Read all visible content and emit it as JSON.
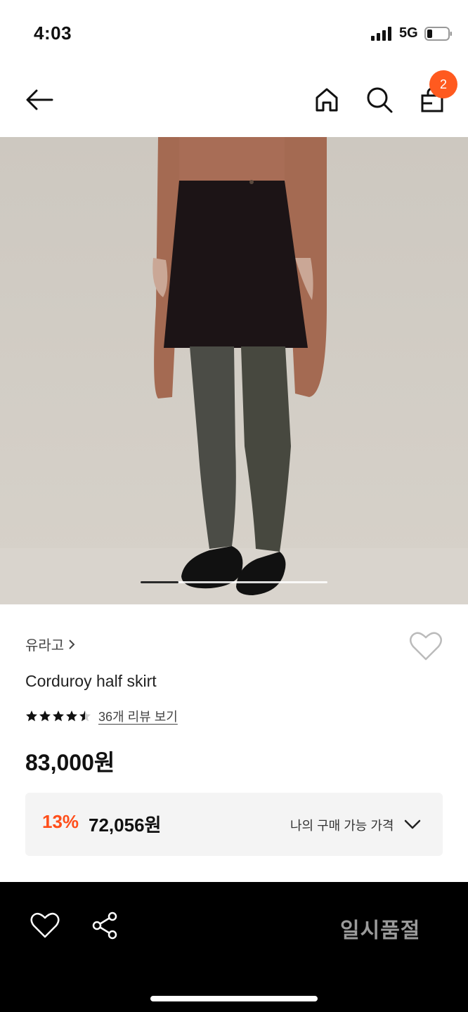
{
  "status_bar": {
    "time": "4:03",
    "network": "5G"
  },
  "header": {
    "cart_count": "2"
  },
  "product": {
    "brand": "유라고",
    "name": "Corduroy half skirt",
    "rating_value": 4.5,
    "rating_max": 5,
    "review_link": "36개 리뷰 보기",
    "price": "83,000원",
    "discount": {
      "rate": "13%",
      "price": "72,056원",
      "label": "나의 구매 가능 가격"
    },
    "image_count_hint": {
      "current_index": 1,
      "progress_fraction": 0.2
    }
  },
  "bottom_bar": {
    "soldout_label": "일시품절"
  },
  "colors": {
    "accent": "#ff5a1f",
    "discount": "#ff4e1a",
    "bar_bg": "#000000",
    "soldout_text": "#9a9a9a"
  }
}
